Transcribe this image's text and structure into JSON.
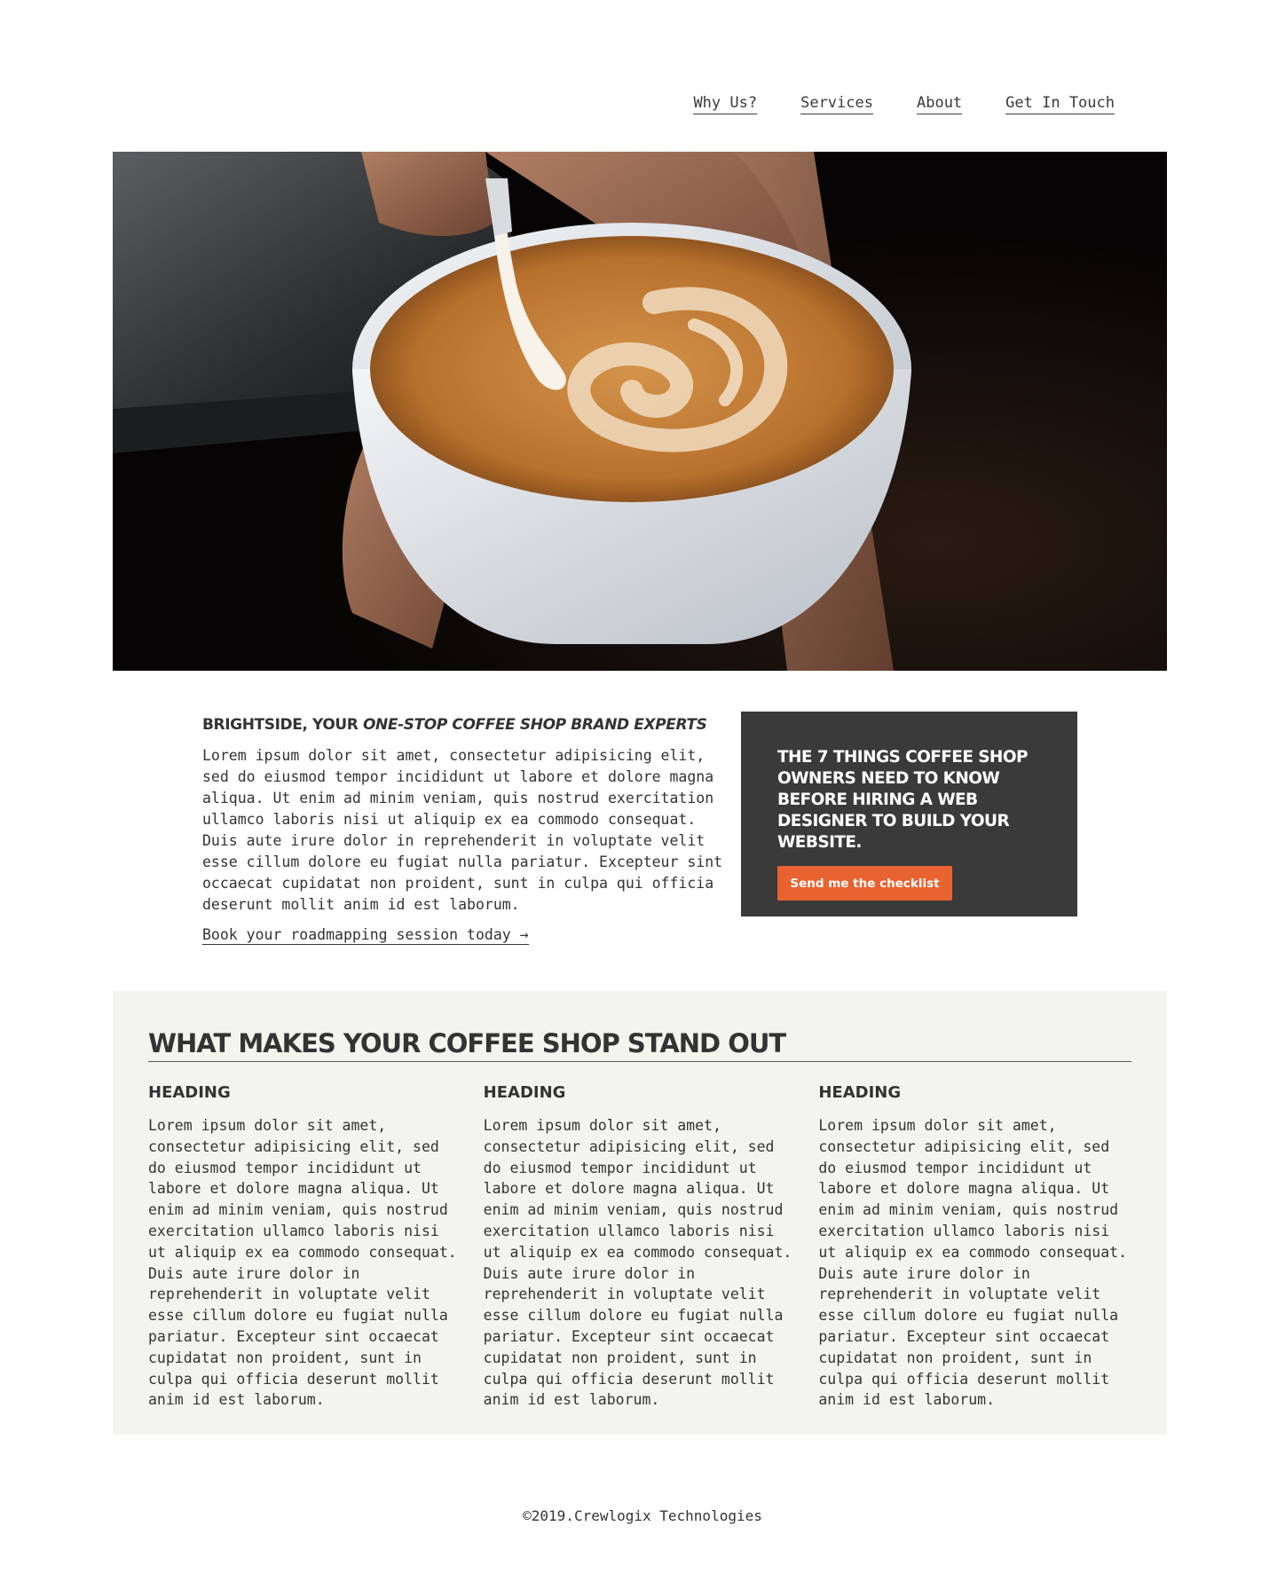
{
  "nav": {
    "items": [
      "Why Us?",
      "Services",
      "About",
      "Get In Touch"
    ]
  },
  "hero": {
    "image": "latte-art-pour-photo"
  },
  "intro": {
    "title_plain": "BRIGHTSIDE, YOUR ",
    "title_emphasis": "ONE-STOP COFFEE SHOP BRAND EXPERTS",
    "body": "Lorem ipsum dolor sit amet, consectetur adipisicing elit, sed do eiusmod tempor incididunt ut labore et dolore magna aliqua. Ut enim ad minim veniam, quis nostrud exercitation ullamco laboris nisi ut aliquip ex ea commodo consequat. Duis aute irure dolor in reprehenderit in voluptate velit esse cillum dolore eu fugiat nulla pariatur. Excepteur sint occaecat cupidatat non proident, sunt in culpa qui officia deserunt mollit anim id est laborum.",
    "link": "Book your roadmapping session today →"
  },
  "cta": {
    "heading": "THE 7 THINGS COFFEE SHOP OWNERS NEED TO KNOW BEFORE HIRING A WEB DESIGNER TO BUILD YOUR WEBSITE.",
    "button": "Send me the checklist"
  },
  "features": {
    "title": "WHAT MAKES YOUR COFFEE SHOP STAND OUT",
    "columns": [
      {
        "heading": "HEADING",
        "body": "Lorem ipsum dolor sit amet, consectetur adipisicing elit, sed do eiusmod tempor incididunt ut labore et dolore magna aliqua. Ut enim ad minim veniam, quis nostrud exercitation ullamco laboris nisi ut aliquip ex ea commodo consequat. Duis aute irure dolor in reprehenderit in voluptate velit esse cillum dolore eu fugiat nulla pariatur. Excepteur sint occaecat cupidatat non proident, sunt in culpa qui officia deserunt mollit anim id est laborum."
      },
      {
        "heading": "HEADING",
        "body": "Lorem ipsum dolor sit amet, consectetur adipisicing elit, sed do eiusmod tempor incididunt ut labore et dolore magna aliqua. Ut enim ad minim veniam, quis nostrud exercitation ullamco laboris nisi ut aliquip ex ea commodo consequat. Duis aute irure dolor in reprehenderit in voluptate velit esse cillum dolore eu fugiat nulla pariatur. Excepteur sint occaecat cupidatat non proident, sunt in culpa qui officia deserunt mollit anim id est laborum."
      },
      {
        "heading": "HEADING",
        "body": "Lorem ipsum dolor sit amet, consectetur adipisicing elit, sed do eiusmod tempor incididunt ut labore et dolore magna aliqua. Ut enim ad minim veniam, quis nostrud exercitation ullamco laboris nisi ut aliquip ex ea commodo consequat. Duis aute irure dolor in reprehenderit in voluptate velit esse cillum dolore eu fugiat nulla pariatur. Excepteur sint occaecat cupidatat non proident, sunt in culpa qui officia deserunt mollit anim id est laborum."
      }
    ]
  },
  "footer": {
    "text": "©2019.Crewlogix Technologies"
  },
  "colors": {
    "accent": "#e8632f",
    "cta_background": "#3a3a3a",
    "features_background": "#f4f4ef",
    "text": "#333333"
  }
}
